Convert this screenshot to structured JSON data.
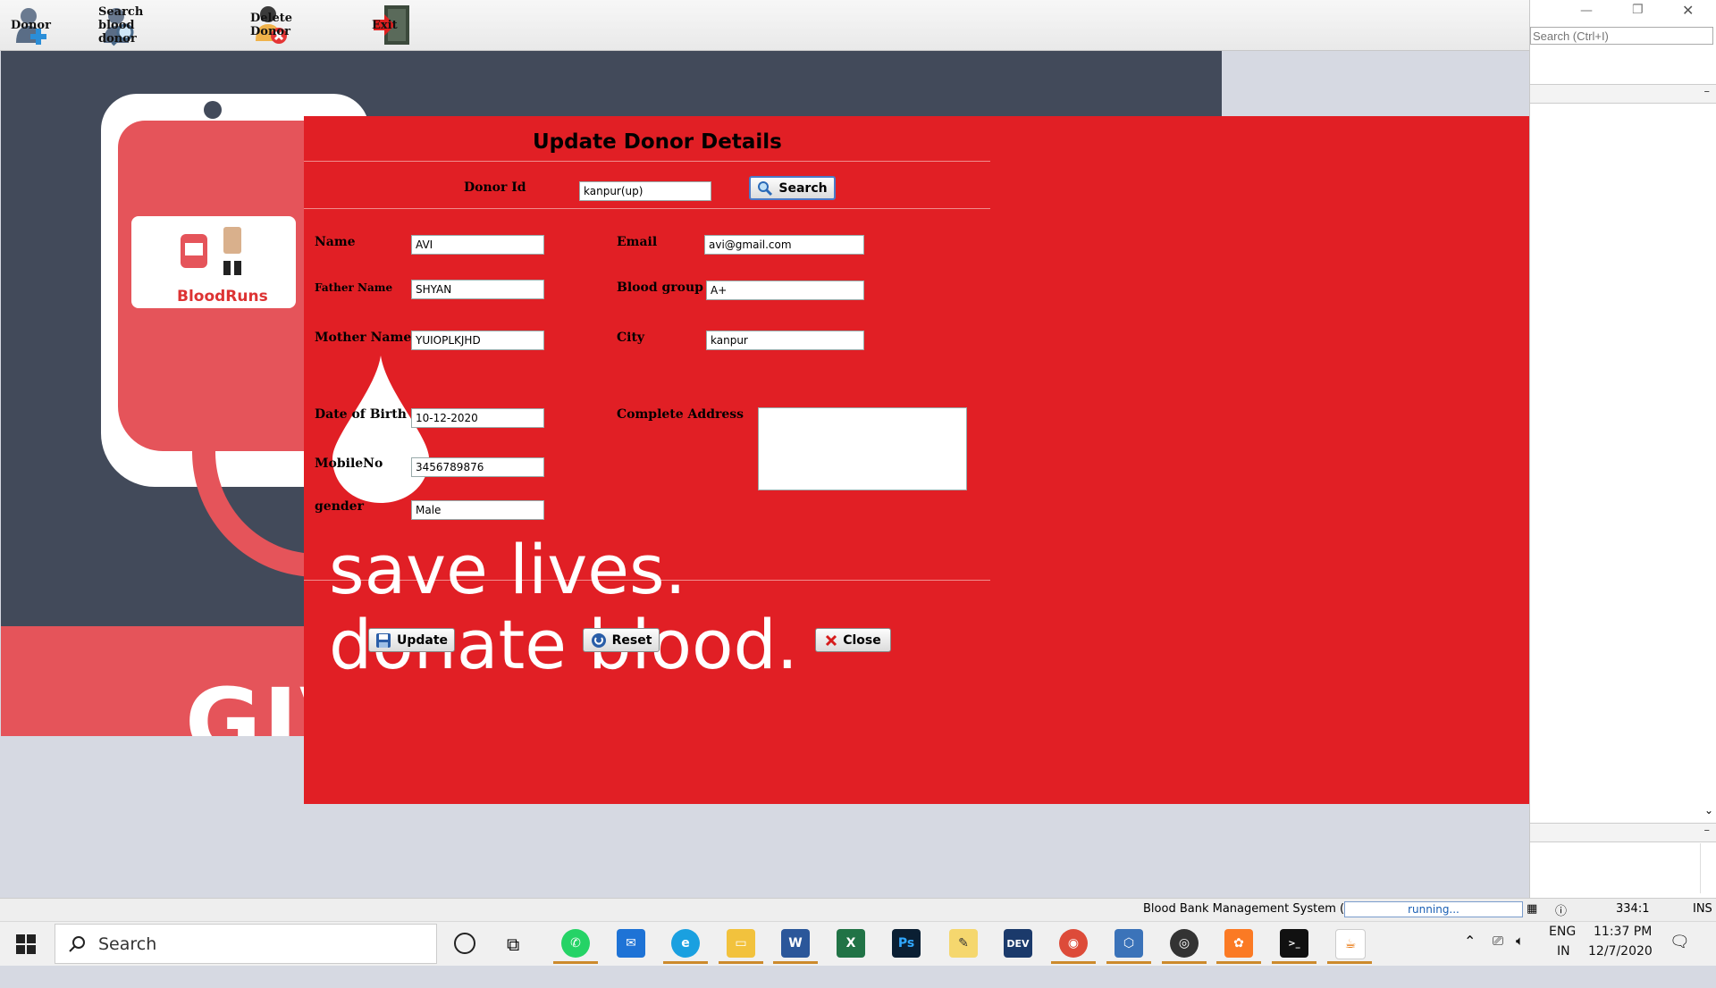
{
  "toolbar": {
    "items": [
      {
        "label": "Donor",
        "icon": "add-user-icon"
      },
      {
        "label": "Search blood donor",
        "icon": "search-user-icon"
      },
      {
        "label": "Delete Donor",
        "icon": "delete-user-icon"
      },
      {
        "label": "Exit",
        "icon": "exit-door-icon"
      }
    ]
  },
  "poster": {
    "logo_text": "BloodRuns",
    "big_text": "GIV",
    "slogan_line1": "save lives.",
    "slogan_line2": "donate blood."
  },
  "dialog": {
    "title": "Update Donor Details",
    "donor_id_label": "Donor Id",
    "donor_id_value": "kanpur(up)",
    "search_label": "Search",
    "fields": {
      "name_label": "Name",
      "name_value": "AVI",
      "father_label": "Father Name",
      "father_value": "SHYAN",
      "mother_label": "Mother Name",
      "mother_value": "YUIOPLKJHD",
      "dob_label": "Date of Birth",
      "dob_value": "10-12-2020",
      "mobile_label": "MobileNo",
      "mobile_value": "3456789876",
      "gender_label": "gender",
      "gender_value": "Male",
      "email_label": "Email",
      "email_value": "avi@gmail.com",
      "blood_label": "Blood group",
      "blood_value": "A+",
      "city_label": "City",
      "city_value": "kanpur",
      "address_label": "Complete Address",
      "address_value": ""
    },
    "update_label": "Update",
    "reset_label": "Reset",
    "close_label": "Close"
  },
  "side": {
    "search_placeholder": "Search (Ctrl+I)"
  },
  "status": {
    "app": "Blood Bank Management System (run)",
    "progress": "running...",
    "position": "334:1",
    "mode": "INS"
  },
  "taskbar": {
    "search_label": "Search",
    "lang1": "ENG",
    "lang2": "IN",
    "time": "11:37 PM",
    "date": "12/7/2020",
    "apps": [
      "whatsapp-icon",
      "mail-icon",
      "edge-icon",
      "file-explorer-icon",
      "word-icon",
      "excel-icon",
      "photoshop-icon",
      "notepad-icon",
      "devcpp-icon",
      "chrome-icon",
      "virtualbox-icon",
      "media-player-icon",
      "xampp-icon",
      "cmd-icon",
      "java-icon"
    ]
  },
  "colors": {
    "dialog_bg": "#e11f25",
    "poster_bg": "#424a5a",
    "poster_red": "#e5545a"
  }
}
